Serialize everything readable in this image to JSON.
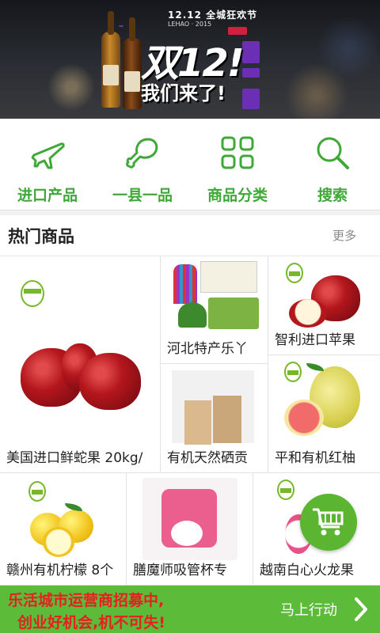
{
  "banner": {
    "top_text": "12.12 全城狂欢节",
    "sub_text": "LEHAO · 2015",
    "title": "双12!",
    "subtitle": "我们来了!"
  },
  "quicknav": [
    {
      "label": "进口产品",
      "icon": "airplane-icon"
    },
    {
      "label": "一县一品",
      "icon": "drumstick-icon"
    },
    {
      "label": "商品分类",
      "icon": "grid-icon"
    },
    {
      "label": "搜索",
      "icon": "search-icon"
    }
  ],
  "hot": {
    "title": "热门商品",
    "more": "更多",
    "items": [
      {
        "name": "美国进口鲜蛇果 20kg/"
      },
      {
        "name": "河北特产乐丫"
      },
      {
        "name": "智利进口苹果"
      },
      {
        "name": "有机天然硒贡"
      },
      {
        "name": "平和有机红柚"
      },
      {
        "name": "赣州有机柠檬 8个"
      },
      {
        "name": "膳魔师吸管杯专"
      },
      {
        "name": "越南白心火龙果"
      }
    ]
  },
  "footer": {
    "line1": "乐活城市运营商招募中,",
    "line2": "创业好机会,机不可失!",
    "cta": "马上行动"
  },
  "colors": {
    "accent": "#3fa838",
    "footer_bg": "#5dbb3a",
    "footer_text": "#e52020"
  }
}
